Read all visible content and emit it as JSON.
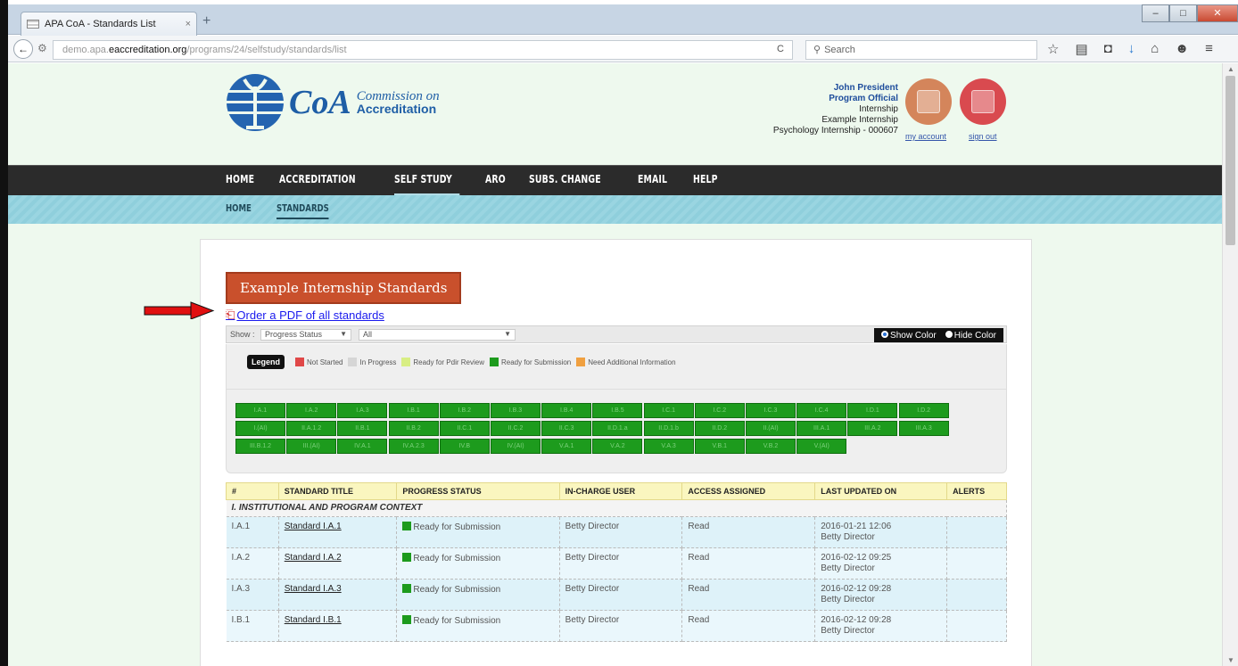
{
  "browser": {
    "tab_title": "APA CoA - Standards List",
    "tab_close": "×",
    "new_tab": "+",
    "url_prefix": "demo.apa.",
    "url_domain": "eaccreditation.org",
    "url_path": "/programs/24/selfstudy/standards/list",
    "search_placeholder": "Search",
    "win_min": "–",
    "win_max": "□",
    "win_close": "✕"
  },
  "header": {
    "logo_mark": "CoA",
    "logo_line1": "Commission on",
    "logo_line2": "Accreditation",
    "user_name": "John President",
    "user_role": "Program Official",
    "user_line3": "Internship",
    "user_line4": "Example Internship",
    "user_line5": "Psychology Internship - 000607",
    "my_account": "my account",
    "sign_out": "sign out"
  },
  "main_nav": [
    "HOME",
    "ACCREDITATION",
    "SELF STUDY",
    "ARO",
    "SUBS. CHANGE",
    "EMAIL",
    "HELP"
  ],
  "main_nav_active": "SELF STUDY",
  "sub_nav": [
    "HOME",
    "STANDARDS"
  ],
  "content": {
    "title": "Example Internship Standards",
    "pdf_link": "Order a PDF of all standards",
    "show_label": "Show :",
    "filter1": "Progress Status",
    "filter2": "All",
    "show_color": "Show Color",
    "hide_color": "Hide Color"
  },
  "legend": {
    "label": "Legend",
    "items": [
      {
        "label": "Not Started",
        "color": "#e04848"
      },
      {
        "label": "In Progress",
        "color": "#d6d6d6"
      },
      {
        "label": "Ready for Pdir Review",
        "color": "#d8ee84"
      },
      {
        "label": "Ready for Submission",
        "color": "#1d9b1d"
      },
      {
        "label": "Need Additional Information",
        "color": "#f0a040"
      }
    ]
  },
  "standard_boxes": [
    [
      "I.A.1",
      "I.A.2",
      "I.A.3",
      "I.B.1",
      "I.B.2",
      "I.B.3",
      "I.B.4",
      "I.B.5",
      "I.C.1",
      "I.C.2",
      "I.C.3",
      "I.C.4",
      "I.D.1",
      "I.D.2"
    ],
    [
      "I.(AI)",
      "II.A.1.2",
      "II.B.1",
      "II.B.2",
      "II.C.1",
      "II.C.2",
      "II.C.3",
      "II.D.1.a",
      "II.D.1.b",
      "II.D.2",
      "II.(AI)",
      "III.A.1",
      "III.A.2",
      "III.A.3"
    ],
    [
      "III.B.1.2",
      "III.(AI)",
      "IV.A.1",
      "IV.A.2.3",
      "IV.B",
      "IV.(AI)",
      "V.A.1",
      "V.A.2",
      "V.A.3",
      "V.B.1",
      "V.B.2",
      "V.(AI)"
    ]
  ],
  "table": {
    "headers": [
      "#",
      "STANDARD TITLE",
      "PROGRESS STATUS",
      "IN-CHARGE USER",
      "ACCESS ASSIGNED",
      "LAST UPDATED ON",
      "ALERTS"
    ],
    "section": "I. INSTITUTIONAL AND PROGRAM CONTEXT",
    "rows": [
      {
        "num": "I.A.1",
        "title": "Standard I.A.1",
        "status": "Ready for Submission",
        "user": "Betty Director",
        "access": "Read",
        "updated": "2016-01-21 12:06",
        "updated_by": "Betty Director"
      },
      {
        "num": "I.A.2",
        "title": "Standard I.A.2",
        "status": "Ready for Submission",
        "user": "Betty Director",
        "access": "Read",
        "updated": "2016-02-12 09:25",
        "updated_by": "Betty Director"
      },
      {
        "num": "I.A.3",
        "title": "Standard I.A.3",
        "status": "Ready for Submission",
        "user": "Betty Director",
        "access": "Read",
        "updated": "2016-02-12 09:28",
        "updated_by": "Betty Director"
      },
      {
        "num": "I.B.1",
        "title": "Standard I.B.1",
        "status": "Ready for Submission",
        "user": "Betty Director",
        "access": "Read",
        "updated": "2016-02-12 09:28",
        "updated_by": "Betty Director"
      }
    ]
  }
}
